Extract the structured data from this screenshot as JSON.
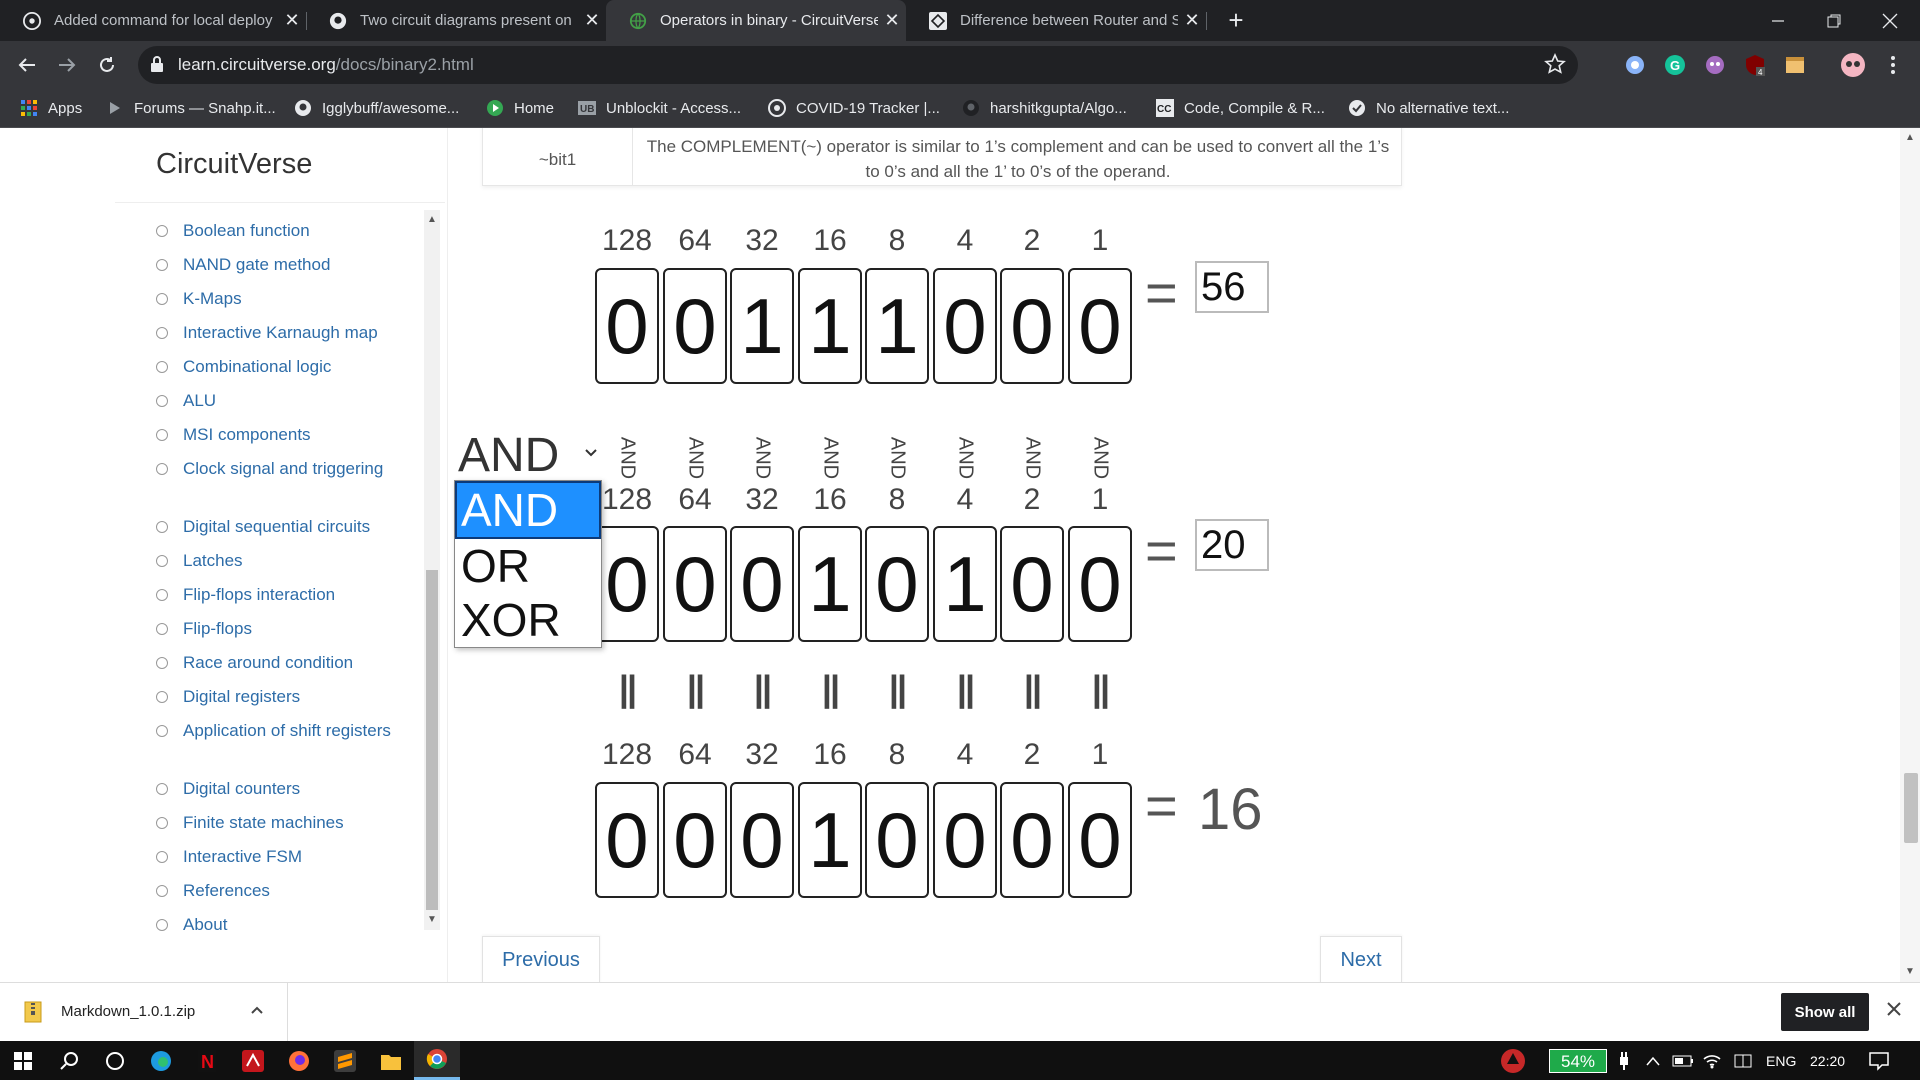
{
  "tabs": [
    {
      "title": "Added command for local deploy",
      "icon": "github-icon",
      "active": false
    },
    {
      "title": "Two circuit diagrams present on",
      "icon": "github-icon",
      "active": false
    },
    {
      "title": "Operators in binary - CircuitVerse",
      "icon": "globe-icon",
      "active": true
    },
    {
      "title": "Difference between Router and S",
      "icon": "geeks-icon",
      "active": false
    }
  ],
  "address": {
    "host": "learn.circuitverse.org",
    "path": "/docs/binary2.html"
  },
  "bookmarks": [
    {
      "label": "Apps",
      "icon": "apps-grid-icon"
    },
    {
      "label": "Forums — Snahp.it...",
      "icon": "play-triangle-icon"
    },
    {
      "label": "Igglybuff/awesome...",
      "icon": "github-icon"
    },
    {
      "label": "Home",
      "icon": "play-circle-icon"
    },
    {
      "label": "Unblockit - Access...",
      "icon": "ub-icon"
    },
    {
      "label": "COVID-19 Tracker |...",
      "icon": "covid-icon"
    },
    {
      "label": "harshitkgupta/Algo...",
      "icon": "github-icon"
    },
    {
      "label": "Code, Compile & R...",
      "icon": "cc-icon"
    },
    {
      "label": "No alternative text...",
      "icon": "globe-icon"
    }
  ],
  "sidebar": {
    "brand": "CircuitVerse",
    "items": [
      "Boolean function",
      "NAND gate method",
      "K-Maps",
      "Interactive Karnaugh map",
      "Combinational logic",
      "ALU",
      "MSI components",
      "Clock signal and triggering",
      "Digital sequential circuits",
      "Latches",
      "Flip-flops interaction",
      "Flip-flops",
      "Race around condition",
      "Digital registers",
      "Application of shift registers",
      "Digital counters",
      "Finite state machines",
      "Interactive FSM",
      "References",
      "About"
    ]
  },
  "complement": {
    "op": "~bit1",
    "desc": "The COMPLEMENT(~) operator is similar to 1’s complement and can be used to convert all the 1’s to 0’s and all the 1’ to 0’s of the operand."
  },
  "weights": [
    "128",
    "64",
    "32",
    "16",
    "8",
    "4",
    "2",
    "1"
  ],
  "row1": {
    "bits": [
      "0",
      "0",
      "1",
      "1",
      "1",
      "0",
      "0",
      "0"
    ],
    "value": "56"
  },
  "row2": {
    "bits": [
      "0",
      "0",
      "0",
      "1",
      "0",
      "1",
      "0",
      "0"
    ],
    "value": "20"
  },
  "row3": {
    "bits": [
      "0",
      "0",
      "0",
      "1",
      "0",
      "0",
      "0",
      "0"
    ],
    "value": "16"
  },
  "equals": "=",
  "op_labels": [
    "AND",
    "AND",
    "AND",
    "AND",
    "AND",
    "AND",
    "AND",
    "AND"
  ],
  "eq_marks": [
    "||",
    "||",
    "||",
    "||",
    "||",
    "||",
    "||",
    "||"
  ],
  "select": {
    "value": "AND",
    "options": [
      "AND",
      "OR",
      "XOR"
    ],
    "highlighted": "AND"
  },
  "pager": {
    "prev": "Previous",
    "next": "Next"
  },
  "download": {
    "filename": "Markdown_1.0.1.zip",
    "show_all": "Show all"
  },
  "tray": {
    "battery": "54%",
    "lang": "ENG",
    "time": "22:20"
  }
}
